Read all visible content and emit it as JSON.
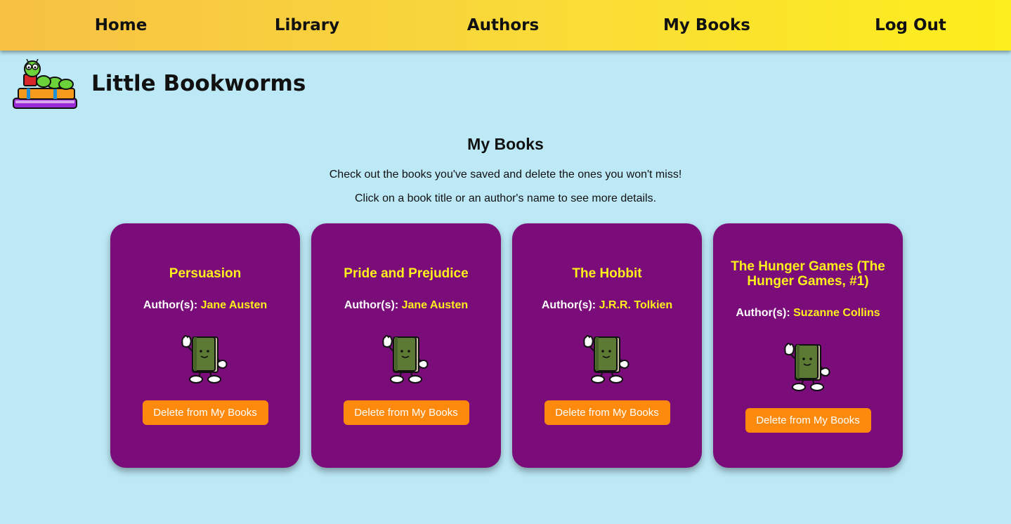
{
  "nav": {
    "items": [
      {
        "label": "Home"
      },
      {
        "label": "Library"
      },
      {
        "label": "Authors"
      },
      {
        "label": "My Books"
      },
      {
        "label": "Log Out"
      }
    ]
  },
  "brand": {
    "title": "Little Bookworms",
    "logo_icon": "bookworm-on-books-icon"
  },
  "page": {
    "heading": "My Books",
    "intro_1": "Check out the books you've saved and delete the ones you won't miss!",
    "intro_2": "Click on a book title or an author's name to see more details."
  },
  "books": [
    {
      "title": "Persuasion",
      "author_label": "Author(s):",
      "author": "Jane Austen",
      "delete_label": "Delete from My Books"
    },
    {
      "title": "Pride and Prejudice",
      "author_label": "Author(s):",
      "author": "Jane Austen",
      "delete_label": "Delete from My Books"
    },
    {
      "title": "The Hobbit",
      "author_label": "Author(s):",
      "author": "J.R.R. Tolkien",
      "delete_label": "Delete from My Books"
    },
    {
      "title": "The Hunger Games (The Hunger Games, #1)",
      "author_label": "Author(s):",
      "author": "Suzanne Collins",
      "delete_label": "Delete from My Books"
    }
  ],
  "colors": {
    "background": "#bde9f7",
    "card": "#7b0d7b",
    "accent_yellow": "#ffef1a",
    "button_orange": "#fe8a0d"
  }
}
